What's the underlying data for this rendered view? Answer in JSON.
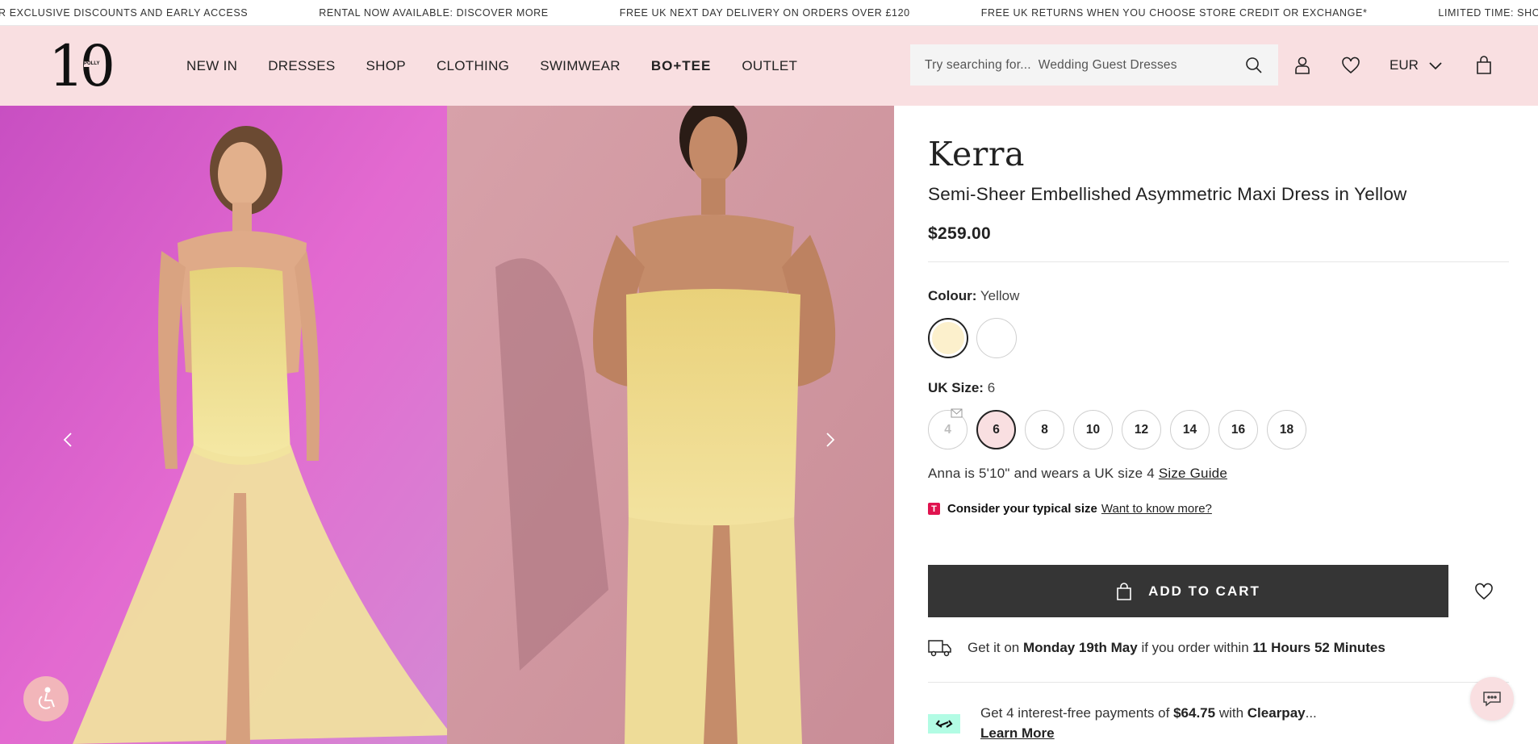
{
  "ticker": {
    "items": [
      "R EXCLUSIVE DISCOUNTS AND EARLY ACCESS",
      "RENTAL NOW AVAILABLE: DISCOVER MORE",
      "FREE UK NEXT DAY DELIVERY ON ORDERS OVER £120",
      "FREE UK RETURNS WHEN YOU CHOOSE STORE CREDIT OR EXCHANGE*",
      "LIMITED TIME: SHOP"
    ]
  },
  "header": {
    "logo_text": "10",
    "logo_mark": "POLLY",
    "nav": [
      "NEW IN",
      "DRESSES",
      "SHOP",
      "CLOTHING",
      "SWIMWEAR",
      "BO+TEE",
      "OUTLET"
    ],
    "search_placeholder": "Try searching for...  Wedding Guest Dresses",
    "currency": "EUR",
    "icons": [
      "search-icon",
      "account-icon",
      "heart-icon",
      "chevron-down-icon",
      "bag-icon"
    ]
  },
  "product": {
    "brand": "Kerra",
    "name": "Semi-Sheer Embellished Asymmetric Maxi Dress in Yellow",
    "price": "$259.00",
    "colour_label": "Colour:",
    "colour_value": "Yellow",
    "swatches": [
      {
        "name": "Yellow",
        "color": "#fcf0cc",
        "selected": true
      },
      {
        "name": "White",
        "color": "#ffffff",
        "selected": false
      }
    ],
    "size_label": "UK Size:",
    "size_value": "6",
    "sizes": [
      "4",
      "6",
      "8",
      "10",
      "12",
      "14",
      "16",
      "18"
    ],
    "model_note": "Anna is 5'10\" and wears a UK size 4",
    "size_guide": "Size Guide",
    "typical_badge": "T",
    "typical_text": "Consider your typical size",
    "typical_link": "Want to know more?",
    "add_to_cart": "ADD TO CART",
    "delivery_pre": "Get it on",
    "delivery_date": "Monday 19th May",
    "delivery_mid": "if you order within",
    "delivery_time": "11 Hours 52 Minutes",
    "clearpay_pre": "Get 4 interest-free payments of",
    "clearpay_amount": "$64.75",
    "clearpay_mid": "with",
    "clearpay_brand": "Clearpay",
    "clearpay_ellipsis": "...",
    "clearpay_link": "Learn More"
  },
  "colors": {
    "header_bg": "#f9dfe1",
    "button_dark": "#353535",
    "accent_pink": "#f2b6ba",
    "clearpay_mint": "#b2fce4",
    "badge_red": "#e0134f"
  }
}
